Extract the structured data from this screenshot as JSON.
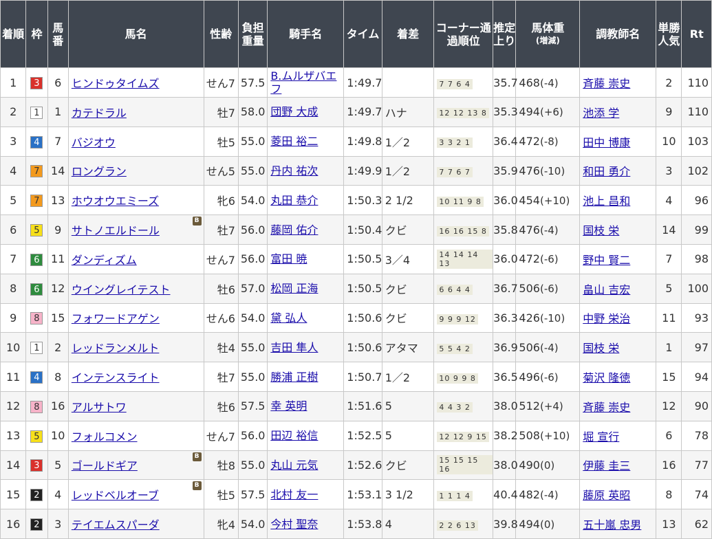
{
  "headers": {
    "rank": "着順",
    "waku": "枠",
    "umaban": "馬番",
    "horse": "馬名",
    "sexage": "性齢",
    "weight": "負担重量",
    "jockey": "騎手名",
    "time": "タイム",
    "margin": "着差",
    "corner": "コーナー通過順位",
    "last3f": "推定上り",
    "bodyweight": "馬体重",
    "bodyweight_sub": "(増減)",
    "trainer": "調教師名",
    "popularity": "単勝人気",
    "rt": "Rt"
  },
  "colors": {
    "header_bg": "#3f4650",
    "waku_1": "#ffffff",
    "waku_2": "#222222",
    "waku_3": "#d9312b",
    "waku_4": "#2a71c6",
    "waku_5": "#f7e01a",
    "waku_6": "#2e8b3e",
    "waku_7": "#f39a1e",
    "waku_8": "#f7b3c9",
    "link": "#1a0dab",
    "corner_bg": "#ecebdd"
  },
  "blinker_label": "B",
  "rows": [
    {
      "rank": "1",
      "waku": "3",
      "umaban": "6",
      "horse": "ヒンドゥタイムズ",
      "blinker": false,
      "sexage": "せん7",
      "weight": "57.5",
      "jockey": "B.ムルザバエフ",
      "time": "1:49.7",
      "margin": "",
      "corner": "7 7 6 4",
      "last3f": "35.7",
      "bw": "468",
      "bwdiff": "(-4)",
      "trainer": "斉藤 崇史",
      "pop": "2",
      "rt": "110"
    },
    {
      "rank": "2",
      "waku": "1",
      "umaban": "1",
      "horse": "カテドラル",
      "blinker": false,
      "sexage": "牡7",
      "weight": "58.0",
      "jockey": "団野 大成",
      "time": "1:49.7",
      "margin": "ハナ",
      "corner": "12 12 13 8",
      "last3f": "35.3",
      "bw": "494",
      "bwdiff": "(+6)",
      "trainer": "池添 学",
      "pop": "9",
      "rt": "110"
    },
    {
      "rank": "3",
      "waku": "4",
      "umaban": "7",
      "horse": "バジオウ",
      "blinker": false,
      "sexage": "牡5",
      "weight": "55.0",
      "jockey": "菱田 裕二",
      "time": "1:49.8",
      "margin": "1／2",
      "corner": "3 3 2 1",
      "last3f": "36.4",
      "bw": "472",
      "bwdiff": "(-8)",
      "trainer": "田中 博康",
      "pop": "10",
      "rt": "103"
    },
    {
      "rank": "4",
      "waku": "7",
      "umaban": "14",
      "horse": "ロングラン",
      "blinker": false,
      "sexage": "せん5",
      "weight": "55.0",
      "jockey": "丹内 祐次",
      "time": "1:49.9",
      "margin": "1／2",
      "corner": "7 7 6 7",
      "last3f": "35.9",
      "bw": "476",
      "bwdiff": "(-10)",
      "trainer": "和田 勇介",
      "pop": "3",
      "rt": "102"
    },
    {
      "rank": "5",
      "waku": "7",
      "umaban": "13",
      "horse": "ホウオウエミーズ",
      "blinker": false,
      "sexage": "牝6",
      "weight": "54.0",
      "jockey": "丸田 恭介",
      "time": "1:50.3",
      "margin": "2 1/2",
      "corner": "10 11 9 8",
      "last3f": "36.0",
      "bw": "454",
      "bwdiff": "(+10)",
      "trainer": "池上 昌和",
      "pop": "4",
      "rt": "96"
    },
    {
      "rank": "6",
      "waku": "5",
      "umaban": "9",
      "horse": "サトノエルドール",
      "blinker": true,
      "sexage": "牡7",
      "weight": "56.0",
      "jockey": "藤岡 佑介",
      "time": "1:50.4",
      "margin": "クビ",
      "corner": "16 16 15 8",
      "last3f": "35.8",
      "bw": "476",
      "bwdiff": "(-4)",
      "trainer": "国枝 栄",
      "pop": "14",
      "rt": "99"
    },
    {
      "rank": "7",
      "waku": "6",
      "umaban": "11",
      "horse": "ダンディズム",
      "blinker": false,
      "sexage": "せん7",
      "weight": "56.0",
      "jockey": "富田 暁",
      "time": "1:50.5",
      "margin": "3／4",
      "corner": "14 14 14 13",
      "last3f": "36.0",
      "bw": "472",
      "bwdiff": "(-6)",
      "trainer": "野中 賢二",
      "pop": "7",
      "rt": "98"
    },
    {
      "rank": "8",
      "waku": "6",
      "umaban": "12",
      "horse": "ウイングレイテスト",
      "blinker": false,
      "sexage": "牡6",
      "weight": "57.0",
      "jockey": "松岡 正海",
      "time": "1:50.5",
      "margin": "クビ",
      "corner": "6 6 4 4",
      "last3f": "36.7",
      "bw": "506",
      "bwdiff": "(-6)",
      "trainer": "畠山 吉宏",
      "pop": "5",
      "rt": "100"
    },
    {
      "rank": "9",
      "waku": "8",
      "umaban": "15",
      "horse": "フォワードアゲン",
      "blinker": false,
      "sexage": "せん6",
      "weight": "54.0",
      "jockey": "黛 弘人",
      "time": "1:50.6",
      "margin": "クビ",
      "corner": "9 9 9 12",
      "last3f": "36.3",
      "bw": "426",
      "bwdiff": "(-10)",
      "trainer": "中野 栄治",
      "pop": "11",
      "rt": "93"
    },
    {
      "rank": "10",
      "waku": "1",
      "umaban": "2",
      "horse": "レッドランメルト",
      "blinker": false,
      "sexage": "牡4",
      "weight": "55.0",
      "jockey": "吉田 隼人",
      "time": "1:50.6",
      "margin": "アタマ",
      "corner": "5 5 4 2",
      "last3f": "36.9",
      "bw": "506",
      "bwdiff": "(-4)",
      "trainer": "国枝 栄",
      "pop": "1",
      "rt": "97"
    },
    {
      "rank": "11",
      "waku": "4",
      "umaban": "8",
      "horse": "インテンスライト",
      "blinker": false,
      "sexage": "牡7",
      "weight": "55.0",
      "jockey": "勝浦 正樹",
      "time": "1:50.7",
      "margin": "1／2",
      "corner": "10 9 9 8",
      "last3f": "36.5",
      "bw": "496",
      "bwdiff": "(-6)",
      "trainer": "菊沢 隆徳",
      "pop": "15",
      "rt": "94"
    },
    {
      "rank": "12",
      "waku": "8",
      "umaban": "16",
      "horse": "アルサトワ",
      "blinker": false,
      "sexage": "牡6",
      "weight": "57.5",
      "jockey": "幸 英明",
      "time": "1:51.6",
      "margin": "5",
      "corner": "4 4 3 2",
      "last3f": "38.0",
      "bw": "512",
      "bwdiff": "(+4)",
      "trainer": "斉藤 崇史",
      "pop": "12",
      "rt": "90"
    },
    {
      "rank": "13",
      "waku": "5",
      "umaban": "10",
      "horse": "フォルコメン",
      "blinker": false,
      "sexage": "せん7",
      "weight": "56.0",
      "jockey": "田辺 裕信",
      "time": "1:52.5",
      "margin": "5",
      "corner": "12 12 9 15",
      "last3f": "38.2",
      "bw": "508",
      "bwdiff": "(+10)",
      "trainer": "堀 宣行",
      "pop": "6",
      "rt": "78"
    },
    {
      "rank": "14",
      "waku": "3",
      "umaban": "5",
      "horse": "ゴールドギア",
      "blinker": true,
      "sexage": "牡8",
      "weight": "55.0",
      "jockey": "丸山 元気",
      "time": "1:52.6",
      "margin": "クビ",
      "corner": "15 15 15 16",
      "last3f": "38.0",
      "bw": "490",
      "bwdiff": "(0)",
      "trainer": "伊藤 圭三",
      "pop": "16",
      "rt": "77"
    },
    {
      "rank": "15",
      "waku": "2",
      "umaban": "4",
      "horse": "レッドベルオーブ",
      "blinker": true,
      "sexage": "牡5",
      "weight": "57.5",
      "jockey": "北村 友一",
      "time": "1:53.1",
      "margin": "3 1/2",
      "corner": "1 1 1 4",
      "last3f": "40.4",
      "bw": "482",
      "bwdiff": "(-4)",
      "trainer": "藤原 英昭",
      "pop": "8",
      "rt": "74"
    },
    {
      "rank": "16",
      "waku": "2",
      "umaban": "3",
      "horse": "テイエムスパーダ",
      "blinker": false,
      "sexage": "牝4",
      "weight": "54.0",
      "jockey": "今村 聖奈",
      "time": "1:53.8",
      "margin": "4",
      "corner": "2 2 6 13",
      "last3f": "39.8",
      "bw": "494",
      "bwdiff": "(0)",
      "trainer": "五十嵐 忠男",
      "pop": "13",
      "rt": "62"
    }
  ]
}
